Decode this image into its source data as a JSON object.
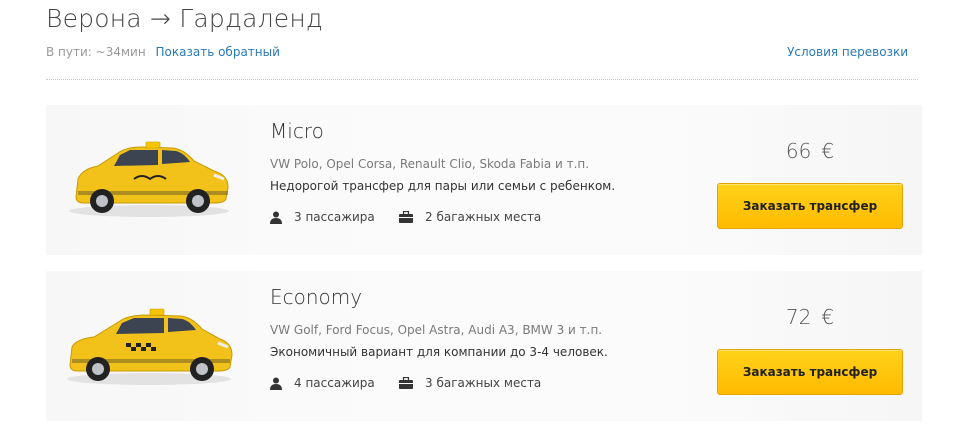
{
  "route": {
    "title": "Верона → Гардаленд"
  },
  "meta": {
    "duration": "В пути: ~34мин",
    "reverse_link": "Показать обратный",
    "conditions_link": "Условия перевозки"
  },
  "cars": [
    {
      "class": "Micro",
      "models": "VW Polo, Opel Corsa, Renault Clio, Skoda Fabia и т.п.",
      "description": "Недорогой трансфер для пары или семьи с ребенком.",
      "passengers": "3 пассажира",
      "luggage": "2 багажных места",
      "price": "66",
      "currency": "€",
      "button": "Заказать трансфер",
      "icons": {
        "car": "hatchback-taxi-icon",
        "passengers": "person-icon",
        "luggage": "briefcase-icon"
      },
      "colors": {
        "body": "#f2c21b",
        "accent": "#f7c500"
      }
    },
    {
      "class": "Economy",
      "models": "VW Golf, Ford Focus, Opel Astra, Audi A3, BMW 3 и т.п.",
      "description": "Экономичный вариант для компании до 3-4 человек.",
      "passengers": "4 пассажира",
      "luggage": "3 багажных места",
      "price": "72",
      "currency": "€",
      "button": "Заказать трансфер",
      "icons": {
        "car": "hatchback-taxi-icon",
        "passengers": "person-icon",
        "luggage": "briefcase-icon"
      },
      "colors": {
        "body": "#f2c21b",
        "accent": "#f7c500"
      }
    }
  ]
}
